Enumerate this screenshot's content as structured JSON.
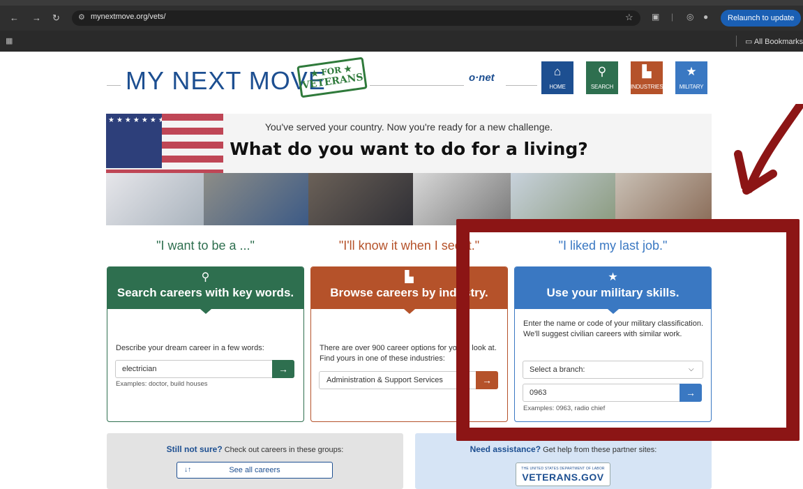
{
  "browser": {
    "url": "mynextmove.org/vets/",
    "relaunch_label": "Relaunch to update",
    "bookmarks_label": "All Bookmarks"
  },
  "header": {
    "logo_text": "MY NEXT MOVE",
    "stamp_line1": "★ FOR ★",
    "stamp_line2": "VETERANS",
    "onet_label": "o·net",
    "nav": [
      {
        "label": "HOME",
        "icon": "home-icon",
        "color": "#1d4f91"
      },
      {
        "label": "SEARCH",
        "icon": "search-key-icon",
        "color": "#2e6f4f"
      },
      {
        "label": "INDUSTRIES",
        "icon": "factory-icon",
        "color": "#b5522a"
      },
      {
        "label": "MILITARY",
        "icon": "star-icon",
        "color": "#3a78c2"
      }
    ]
  },
  "hero": {
    "subtitle": "You've served your country. Now you're ready for a new challenge.",
    "title": "What do you want to do for a living?"
  },
  "taglines": {
    "search": "\"I want to be a ...\"",
    "browse": "\"I'll know it when I see it.\"",
    "military": "\"I liked my last job.\""
  },
  "cards": {
    "search": {
      "title": "Search careers with key words.",
      "description": "Describe your dream career in a few words:",
      "input_value": "electrician",
      "examples": "Examples: doctor, build houses",
      "color": "#2e6f4f"
    },
    "browse": {
      "title": "Browse careers by industry.",
      "description": "There are over 900 career options for you to look at. Find yours in one of these industries:",
      "select_value": "Administration & Support Services",
      "color": "#b5522a"
    },
    "military": {
      "title": "Use your military skills.",
      "description": "Enter the name or code of your military classification. We'll suggest civilian careers with similar work.",
      "branch_select": "Select a branch:",
      "input_value": "0963",
      "examples": "Examples: 0963, radio chief",
      "color": "#3a78c2"
    }
  },
  "bottom": {
    "still_not_sure_bold": "Still not sure?",
    "still_not_sure_rest": " Check out careers in these groups:",
    "see_all_label": "See all careers",
    "assistance_bold": "Need assistance?",
    "assistance_rest": " Get help from these partner sites:",
    "vets_small": "THE UNITED STATES DEPARTMENT OF LABOR",
    "vets_big": "VETERANS.GOV"
  },
  "colors": {
    "annotation": "#8c1515",
    "tagline_search": "#2e6f4f",
    "tagline_browse": "#b5522a",
    "tagline_military": "#3a78c2"
  }
}
